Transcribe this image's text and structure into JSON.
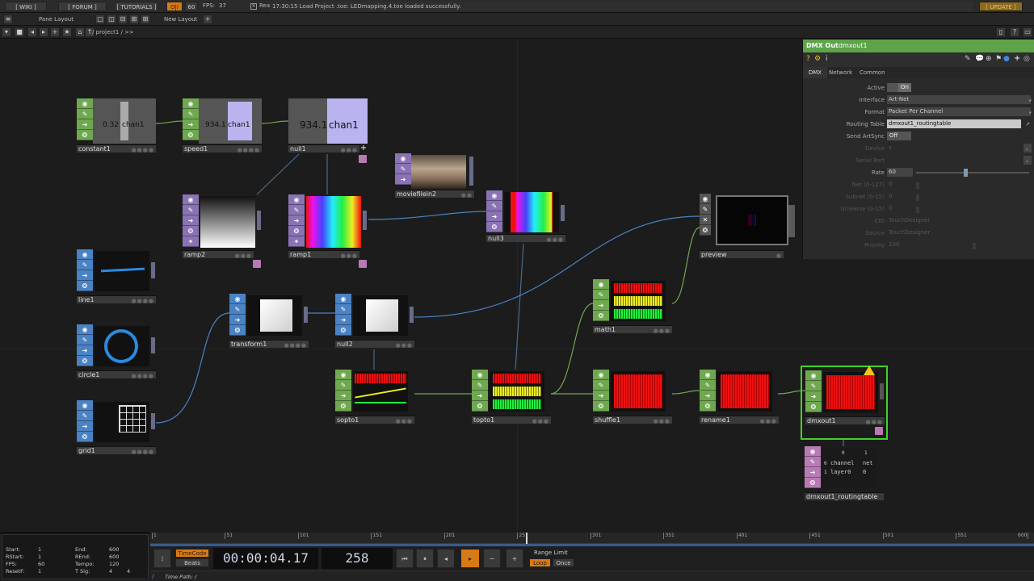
{
  "menubar": {
    "wiki": "[ WIKI ]",
    "forum": "[ FORUM ]",
    "tutorials": "[ TUTORIALS ]",
    "oi": "O|I",
    "sixty": "60",
    "fps_label": "FPS:",
    "fps_value": "37",
    "realtime": "Realtime",
    "status_message": "17:30:15 Load Project .toe: LEDmapping.4.toe loaded successfully.",
    "update": "[ UPDATE ]"
  },
  "panebar": {
    "pane_layout": "Pane Layout",
    "new_layout": "New Layout",
    "plus": "+"
  },
  "pathbar": {
    "path": "/ project1 / >>"
  },
  "nodes": {
    "constant1": {
      "name": "constant1",
      "value": "0.32",
      "channel": "chan1"
    },
    "speed1": {
      "name": "speed1",
      "value": "934.1",
      "channel": "chan1"
    },
    "null1": {
      "name": "null1",
      "value": "934.1",
      "channel": "chan1"
    },
    "moviefilein2": {
      "name": "moviefilein2"
    },
    "ramp2": {
      "name": "ramp2"
    },
    "ramp1": {
      "name": "ramp1"
    },
    "null3": {
      "name": "null3"
    },
    "preview": {
      "name": "preview"
    },
    "line1": {
      "name": "line1"
    },
    "circle1": {
      "name": "circle1"
    },
    "grid1": {
      "name": "grid1"
    },
    "transform1": {
      "name": "transform1"
    },
    "null2": {
      "name": "null2"
    },
    "math1": {
      "name": "math1"
    },
    "sopto1": {
      "name": "sopto1"
    },
    "topto1": {
      "name": "topto1"
    },
    "shuffle1": {
      "name": "shuffle1"
    },
    "rename1": {
      "name": "rename1"
    },
    "dmxout1": {
      "name": "dmxout1"
    },
    "routingtable": {
      "name": "dmxout1_routingtable",
      "header": [
        "0",
        "1"
      ],
      "rows": [
        {
          "index": "0",
          "c0": "channel",
          "c1": "net"
        },
        {
          "index": "1",
          "c0": "layer0",
          "c1": "0"
        }
      ]
    }
  },
  "param": {
    "op_type": "DMX Out",
    "op_name": "dmxout1",
    "tabs": [
      "DMX",
      "Network",
      "Common"
    ],
    "rows": [
      {
        "label": "Active",
        "value": "On"
      },
      {
        "label": "Interface",
        "value": "Art-Net"
      },
      {
        "label": "Format",
        "value": "Packet Per Channel"
      },
      {
        "label": "Routing Table",
        "value": "dmxout1_routingtable"
      },
      {
        "label": "Send ArtSync",
        "value": "Off"
      },
      {
        "label": "Device",
        "value": "x"
      },
      {
        "label": "Serial Port",
        "value": ""
      },
      {
        "label": "Rate",
        "value": "60"
      },
      {
        "label": "Net (0-127)",
        "value": "0"
      },
      {
        "label": "Subnet (0-15)",
        "value": "0"
      },
      {
        "label": "Universe (0-15)",
        "value": "0"
      },
      {
        "label": "CID",
        "value": "TouchDesigner"
      },
      {
        "label": "Source",
        "value": "TouchDesigner"
      },
      {
        "label": "Priority",
        "value": "100"
      }
    ],
    "rate_level": 0.42
  },
  "timeline": {
    "start_label": "Start:",
    "start": "1",
    "end_label": "End:",
    "end": "600",
    "rstart_label": "RStart:",
    "rstart": "1",
    "rend_label": "REnd:",
    "rend": "600",
    "fps_label": "FPS:",
    "fps": "60",
    "tempo_label": "Tempo:",
    "tempo": "120",
    "resetf_label": "ResetF:",
    "resetf": "1",
    "tsig_label": "T Sig:",
    "tsig_a": "4",
    "tsig_b": "4",
    "timecode_btn": "TimeCode",
    "beats_btn": "Beats",
    "timecode": "00:00:04.17",
    "frame": "258",
    "range_limit": "Range Limit",
    "loop": "Loop",
    "once": "Once",
    "time_path": "Time Path: /",
    "ticks": [
      "1",
      "51",
      "101",
      "151",
      "201",
      "251",
      "301",
      "351",
      "401",
      "451",
      "501",
      "551",
      "600"
    ]
  },
  "colors": {
    "chop": "#6fa850",
    "top": "#8a73b4",
    "sop": "#4a82c4",
    "dat": "#b87ab5",
    "accent": "#d87a14",
    "selected": "#43d12b"
  }
}
